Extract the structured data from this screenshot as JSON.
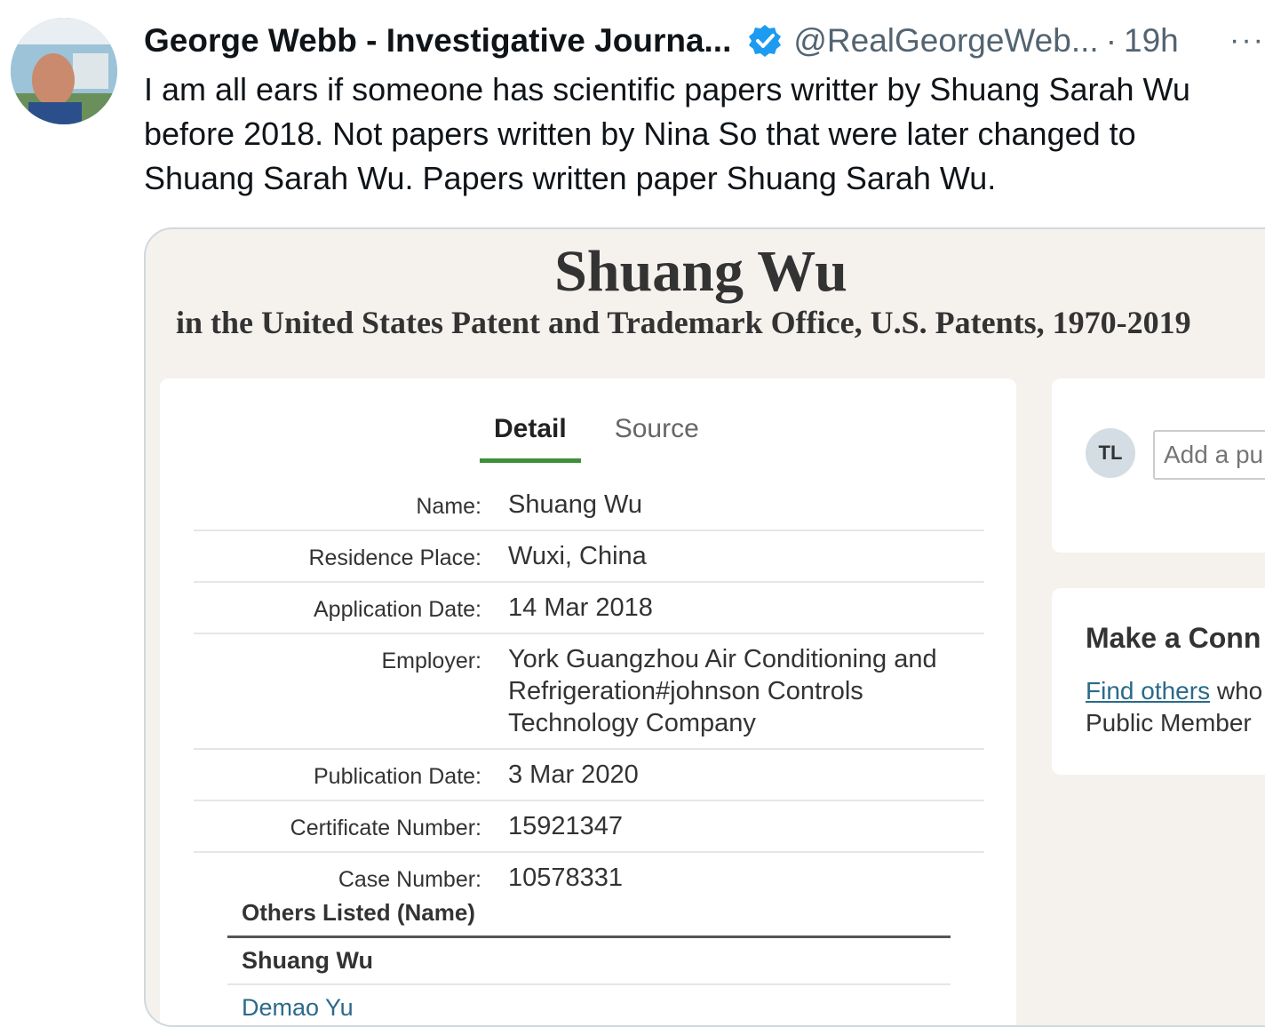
{
  "tweet": {
    "display_name": "George Webb - Investigative Journa...",
    "handle": "@RealGeorgeWeb...",
    "separator": "·",
    "time": "19h",
    "more": "···",
    "text_lines": [
      "I am all ears if someone has scientific papers writter by Shuang Sarah Wu",
      "before 2018.  Not papers written by Nina So that were later changed to",
      "Shuang Sarah Wu. Papers written paper Shuang Sarah Wu."
    ]
  },
  "record": {
    "title": "Shuang Wu",
    "subtitle": "in the United States Patent and Trademark Office, U.S. Patents, 1970-2019",
    "tabs": [
      "Detail",
      "Source"
    ],
    "fields": [
      {
        "label": "Name:",
        "value": "Shuang Wu"
      },
      {
        "label": "Residence Place:",
        "value": "Wuxi, China"
      },
      {
        "label": "Application Date:",
        "value": "14 Mar 2018"
      },
      {
        "label": "Employer:",
        "value": "York Guangzhou Air Conditioning and Refrigeration#johnson Controls Technology Company"
      },
      {
        "label": "Publication Date:",
        "value": "3 Mar 2020"
      },
      {
        "label": "Certificate Number:",
        "value": "15921347"
      },
      {
        "label": "Case Number:",
        "value": "10578331"
      }
    ],
    "others_header": "Others Listed (Name)",
    "others": [
      "Shuang Wu",
      "Demao Yu"
    ]
  },
  "side": {
    "avatar_initials": "TL",
    "comment_placeholder": "Add a pu",
    "connect_title": "Make a Conn",
    "find_others": "Find others",
    "connect_line1_rest": " who",
    "connect_line2": "Public Member"
  },
  "colors": {
    "verified": "#1d9bf0",
    "tab_active": "#3f8f3a",
    "link": "#2b6a8a"
  }
}
